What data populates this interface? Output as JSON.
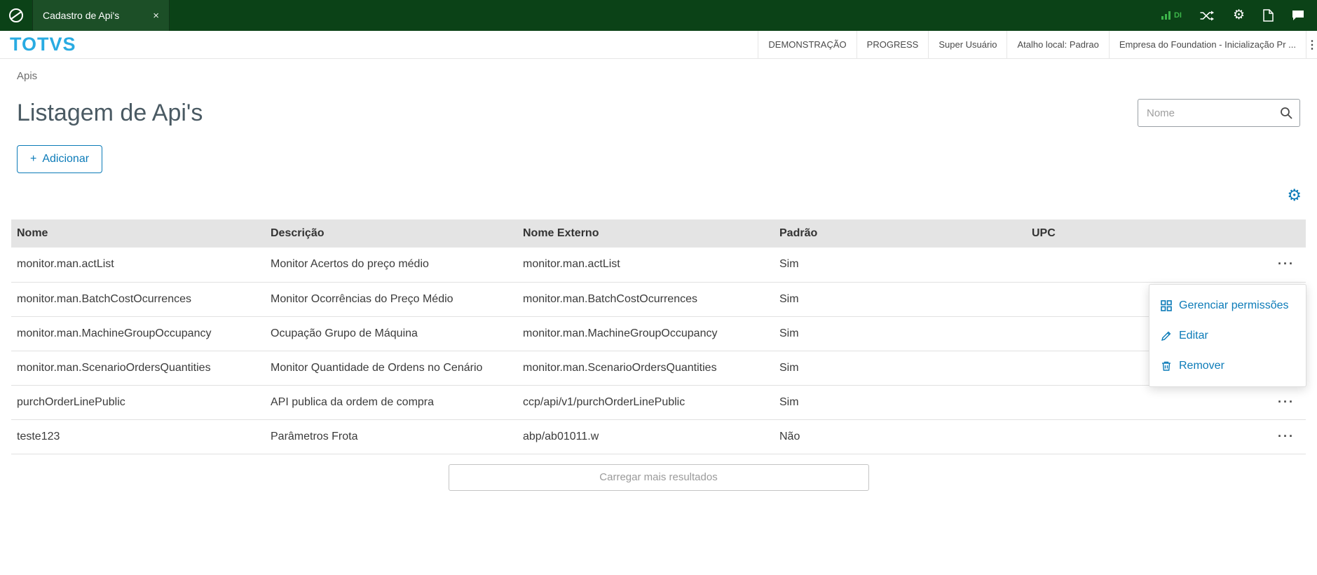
{
  "colors": {
    "topbar": "#0b4217",
    "accent": "#0c7bb8",
    "brand": "#29abe2",
    "signal": "#3cb54a",
    "title": "#4a5a63"
  },
  "icons": {
    "close": "×",
    "gear": "⚙",
    "more": "···",
    "plus": "+",
    "overflow": "⋮"
  },
  "topbar": {
    "tab_label": "Cadastro de Api's",
    "di_label": "DI"
  },
  "header": {
    "brand": "TOTVS",
    "menu": [
      "DEMONSTRAÇÃO",
      "PROGRESS",
      "Super Usuário",
      "Atalho local: Padrao",
      "Empresa do Foundation - Inicialização Pr ..."
    ]
  },
  "breadcrumb": "Apis",
  "page": {
    "title": "Listagem de Api's",
    "search_placeholder": "Nome",
    "add_button": {
      "icon": "+",
      "label": "Adicionar"
    },
    "load_more_label": "Carregar mais resultados"
  },
  "table": {
    "columns": [
      "Nome",
      "Descrição",
      "Nome Externo",
      "Padrão",
      "UPC"
    ],
    "rows": [
      {
        "nome": "monitor.man.actList",
        "descricao": "Monitor Acertos do preço médio",
        "externo": "monitor.man.actList",
        "padrao": "Sim",
        "upc": ""
      },
      {
        "nome": "monitor.man.BatchCostOcurrences",
        "descricao": "Monitor Ocorrências do Preço Médio",
        "externo": "monitor.man.BatchCostOcurrences",
        "padrao": "Sim",
        "upc": ""
      },
      {
        "nome": "monitor.man.MachineGroupOccupancy",
        "descricao": "Ocupação Grupo de Máquina",
        "externo": "monitor.man.MachineGroupOccupancy",
        "padrao": "Sim",
        "upc": ""
      },
      {
        "nome": "monitor.man.ScenarioOrdersQuantities",
        "descricao": "Monitor Quantidade de Ordens no Cenário",
        "externo": "monitor.man.ScenarioOrdersQuantities",
        "padrao": "Sim",
        "upc": ""
      },
      {
        "nome": "purchOrderLinePublic",
        "descricao": "API publica da ordem de compra",
        "externo": "ccp/api/v1/purchOrderLinePublic",
        "padrao": "Sim",
        "upc": ""
      },
      {
        "nome": "teste123",
        "descricao": "Parâmetros Frota",
        "externo": "abp/ab01011.w",
        "padrao": "Não",
        "upc": ""
      }
    ]
  },
  "context_menu": {
    "items": [
      {
        "label": "Gerenciar permissões"
      },
      {
        "label": "Editar"
      },
      {
        "label": "Remover"
      }
    ]
  }
}
